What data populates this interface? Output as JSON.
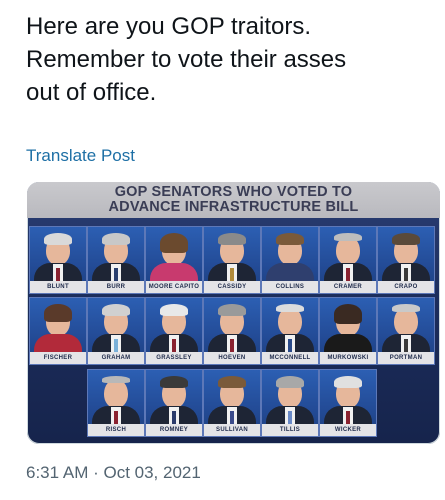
{
  "tweet": {
    "text": "Here are you GOP traitors.\nRemember to vote their asses\nout of office.",
    "translate_label": "Translate Post",
    "timestamp": "6:31 AM · Oct 03, 2021"
  },
  "media": {
    "banner_line1": "GOP SENATORS WHO VOTED TO",
    "banner_line2": "ADVANCE INFRASTRUCTURE BILL",
    "senators_row1": [
      "BLUNT",
      "BURR",
      "MOORE CAPITO",
      "CASSIDY",
      "COLLINS",
      "CRAMER",
      "CRAPO"
    ],
    "senators_row2": [
      "FISCHER",
      "GRAHAM",
      "GRASSLEY",
      "HOEVEN",
      "MCCONNELL",
      "MURKOWSKI",
      "PORTMAN"
    ],
    "senators_row3": [
      "RISCH",
      "ROMNEY",
      "SULLIVAN",
      "TILLIS",
      "WICKER"
    ]
  }
}
